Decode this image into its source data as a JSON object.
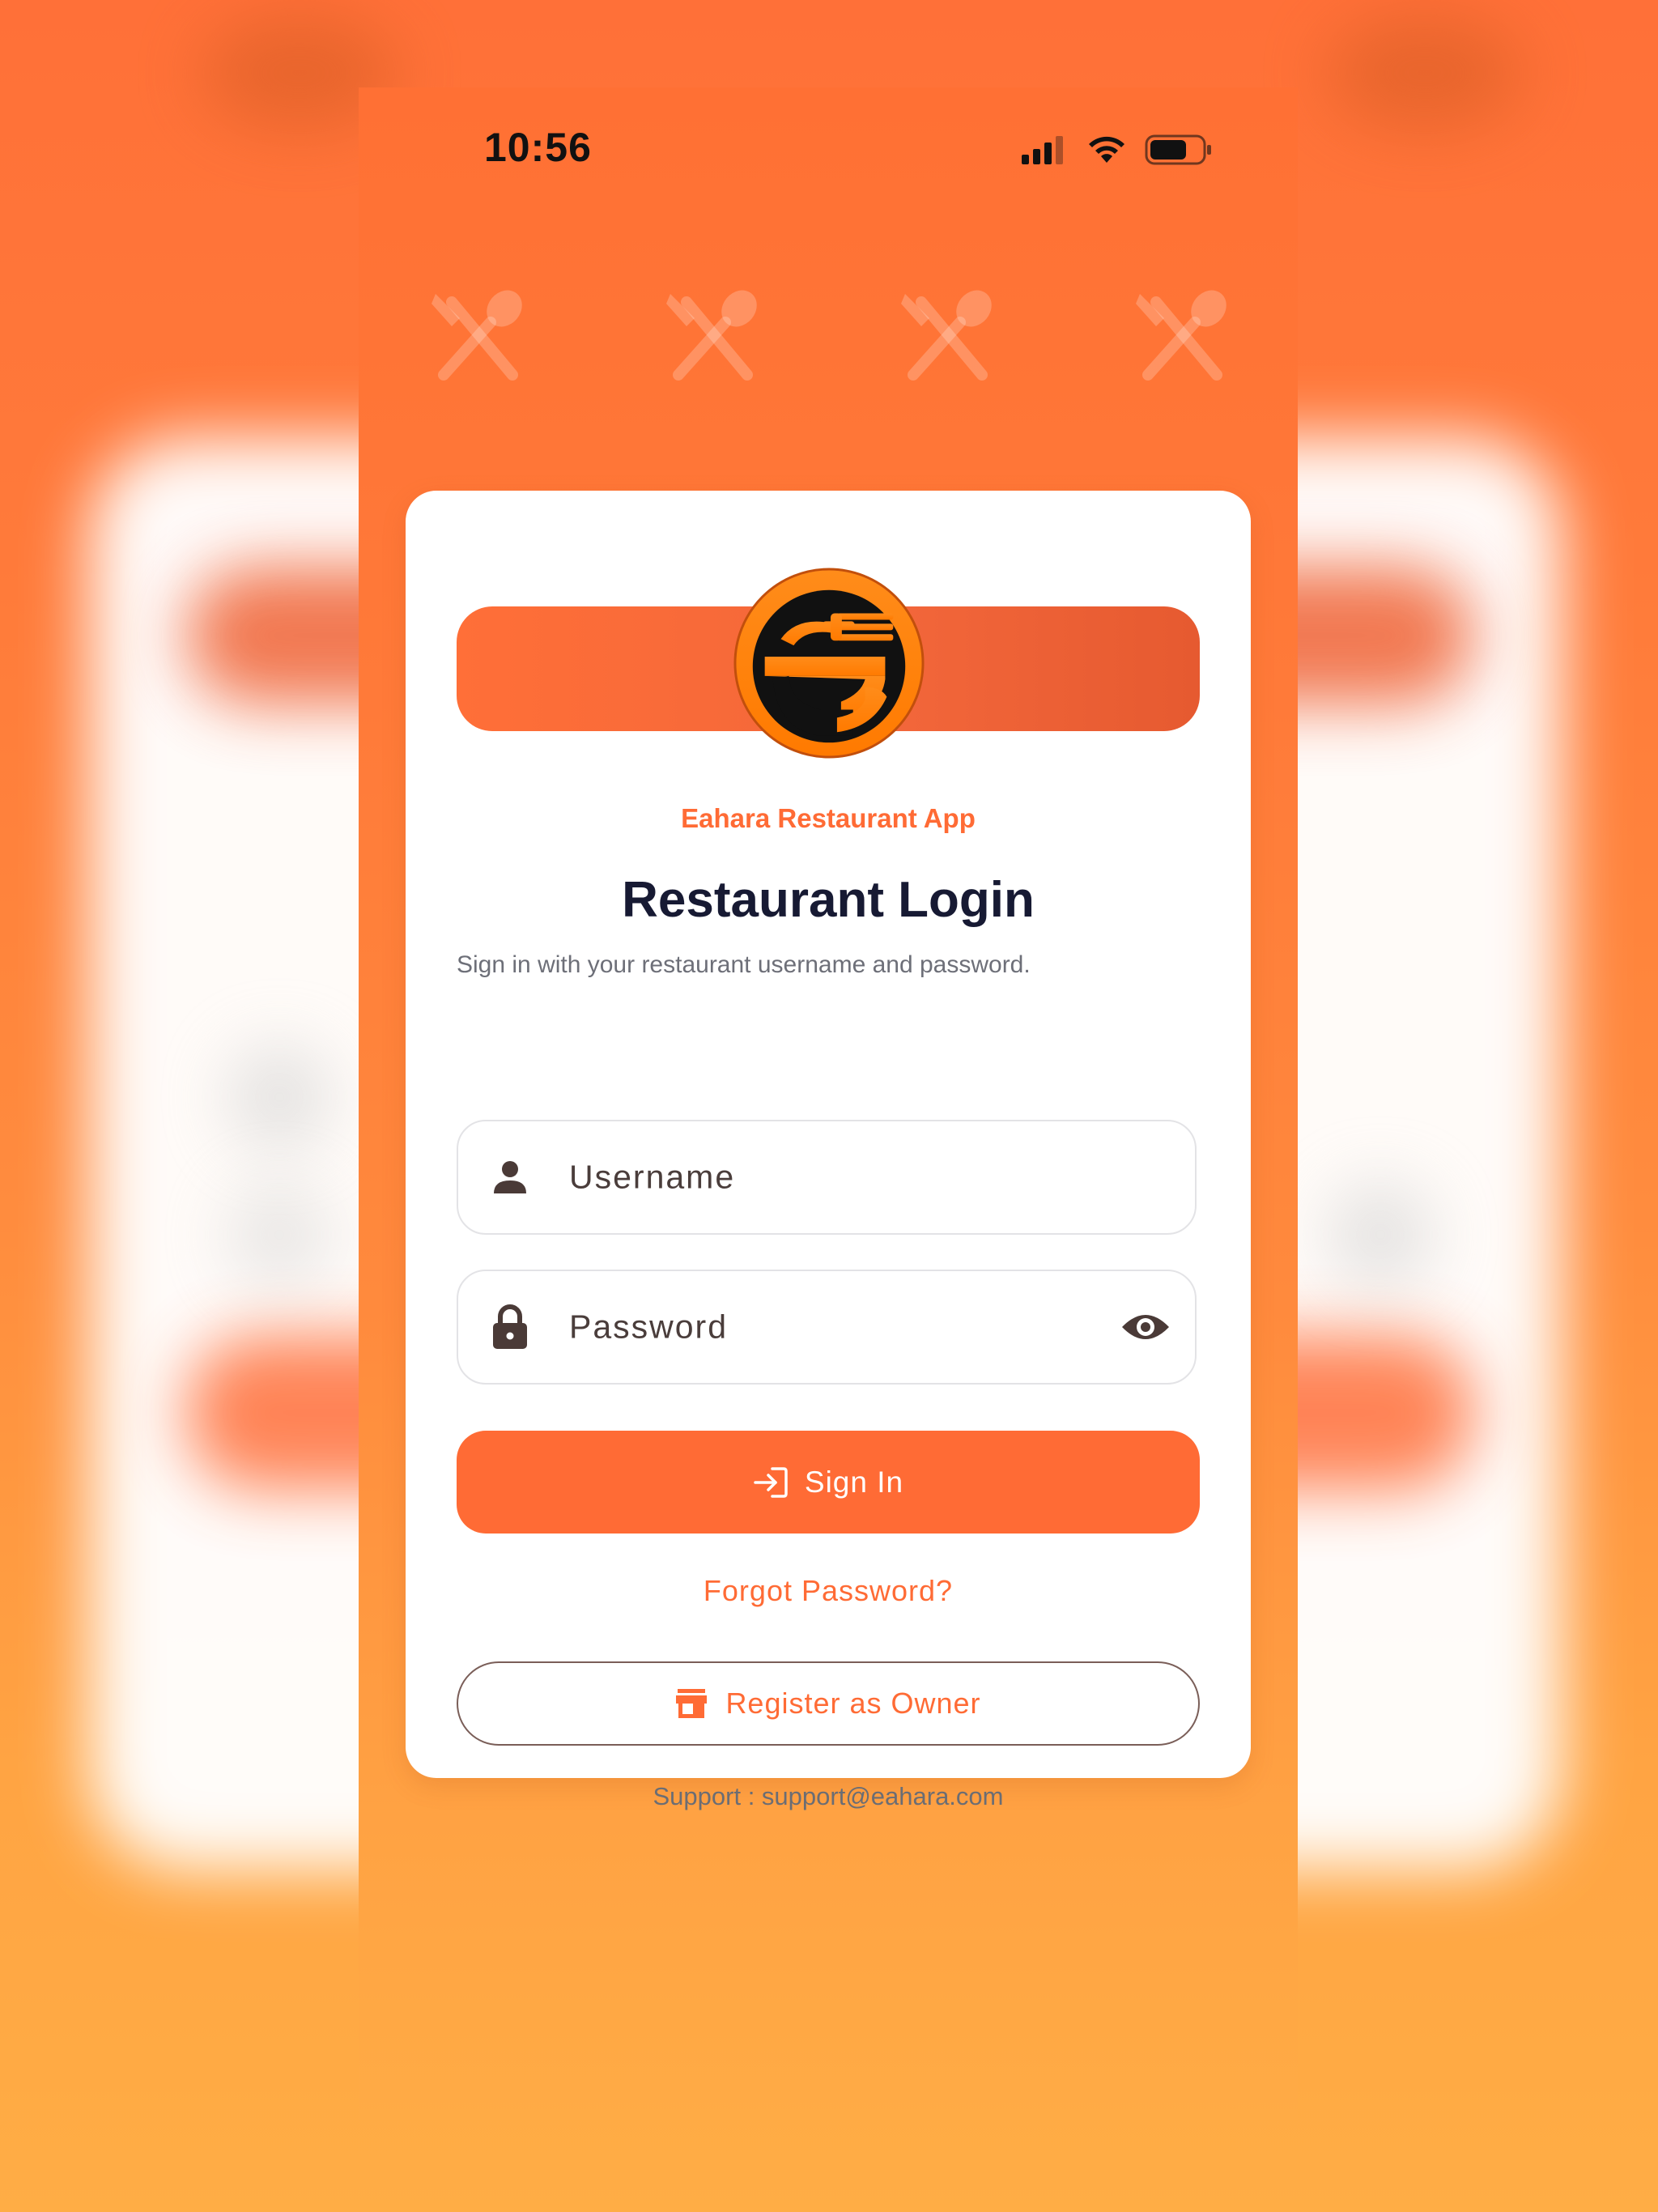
{
  "status_bar": {
    "time": "10:56",
    "icons": [
      "signal-icon",
      "wifi-icon",
      "battery-icon"
    ]
  },
  "brand": {
    "app_name": "Eahara Restaurant App",
    "logo_icon": "eahara-fork-e-logo"
  },
  "login": {
    "title": "Restaurant Login",
    "subtitle": "Sign in with your restaurant username and password.",
    "username_placeholder": "Username",
    "password_placeholder": "Password",
    "sign_in_label": "Sign In",
    "forgot_label": "Forgot Password?",
    "register_label": "Register as Owner",
    "support_text": "Support : support@eahara.com"
  },
  "colors": {
    "accent": "#ff6b35",
    "title": "#171a33",
    "background_top": "#ff7038",
    "background_bottom": "#ffad45"
  }
}
